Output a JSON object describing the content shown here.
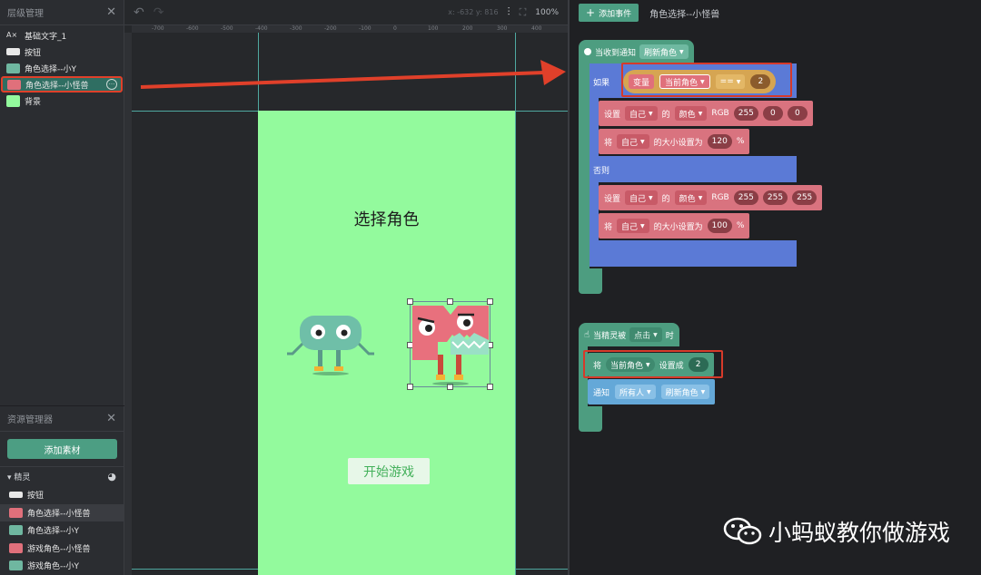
{
  "layer_panel": {
    "title": "层级管理",
    "items": [
      {
        "label": "基础文字_1"
      },
      {
        "label": "按钮"
      },
      {
        "label": "角色选择--小Y"
      },
      {
        "label": "角色选择--小怪兽"
      },
      {
        "label": "背景"
      }
    ]
  },
  "resource_panel": {
    "title": "资源管理器",
    "add_button": "添加素材",
    "section": "精灵",
    "items": [
      {
        "label": "按钮"
      },
      {
        "label": "角色选择--小怪兽"
      },
      {
        "label": "角色选择--小Y"
      },
      {
        "label": "游戏角色--小怪兽"
      },
      {
        "label": "游戏角色--小Y"
      }
    ]
  },
  "stage": {
    "coords": "x: -632  y: 816",
    "zoom": "100%",
    "ruler_top": [
      "-700",
      "-600",
      "-500",
      "-400",
      "-300",
      "-200",
      "-100",
      "0",
      "100",
      "200",
      "300",
      "400"
    ],
    "title": "选择角色",
    "start_button": "开始游戏"
  },
  "code": {
    "add_event": "添加事件",
    "sprite_name": "角色选择--小怪兽",
    "event1": {
      "hat_label": "当收到通知",
      "hat_value": "刷新角色",
      "if_label": "如果",
      "var_label": "变量",
      "var_value": "当前角色",
      "op": "==",
      "compare_value": "2",
      "set_label": "设置",
      "self": "自己",
      "of": "的",
      "color": "颜色",
      "rgb": "RGB",
      "rgb1": [
        "255",
        "0",
        "0"
      ],
      "size_prefix": "将",
      "size_mid": "的大小设置为",
      "size1": "120",
      "pct": "%",
      "else_label": "否则",
      "rgb2": [
        "255",
        "255",
        "255"
      ],
      "size2": "100"
    },
    "event2": {
      "hat_label": "当精灵被",
      "hat_value": "点击",
      "hat_suffix": "时",
      "set_prefix": "将",
      "set_var": "当前角色",
      "set_mid": "设置成",
      "set_value": "2",
      "notify_label": "通知",
      "notify_target": "所有人",
      "notify_msg": "刷新角色"
    }
  },
  "watermark": "小蚂蚁教你做游戏",
  "colors": {
    "accent": "#4c9e83",
    "canvas": "#93fa9d",
    "highlight": "#d63a2a",
    "block_blue": "#5b7ad6",
    "block_pink": "#d9737f"
  }
}
